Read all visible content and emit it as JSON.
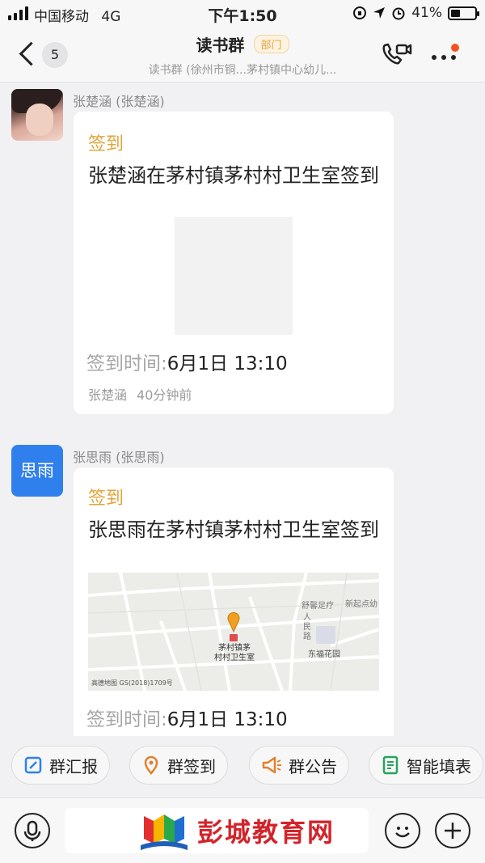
{
  "status_bar": {
    "carrier": "中国移动",
    "network": "4G",
    "time": "下午1:50",
    "battery": "41%",
    "battery_level": 0.41
  },
  "header": {
    "unread_count": "5",
    "title": "读书群",
    "badge": "部门",
    "subtitle": "读书群 (徐州市铜...茅村镇中心幼儿..."
  },
  "messages": [
    {
      "sender": "张楚涵 (张楚涵)",
      "avatar_type": "photo",
      "card_title": "签到",
      "card_body": "张楚涵在茅村镇茅村村卫生室签到",
      "time_label": "签到时间:",
      "time_value": "6月1日 13:10",
      "meta_name": "张楚涵",
      "meta_ago": "40分钟前"
    },
    {
      "sender": "张思雨 (张思雨)",
      "avatar_text": "思雨",
      "avatar_color": "#2f80ed",
      "card_title": "签到",
      "card_body": "张思雨在茅村镇茅村村卫生室签到",
      "map": {
        "poi_main_line1": "茅村镇茅",
        "poi_main_line2": "村村卫生室",
        "poi_road": "人民路",
        "poi_clinic": "舒馨足疗",
        "poi_kindergarten": "新起点幼",
        "poi_garden": "东福花园",
        "credit": "高德地图 GS(2018)1709号"
      },
      "time_label": "签到时间:",
      "time_value": "6月1日 13:10"
    }
  ],
  "quick_actions": [
    {
      "label": "群汇报",
      "icon": "report-icon"
    },
    {
      "label": "群签到",
      "icon": "location-pin-icon"
    },
    {
      "label": "群公告",
      "icon": "megaphone-icon"
    },
    {
      "label": "智能填表",
      "icon": "form-icon"
    }
  ],
  "watermark": "彭城教育网",
  "colors": {
    "accent": "#e0a43a",
    "avatar_blue": "#2f80ed",
    "watermark_red": "#d4232a"
  }
}
